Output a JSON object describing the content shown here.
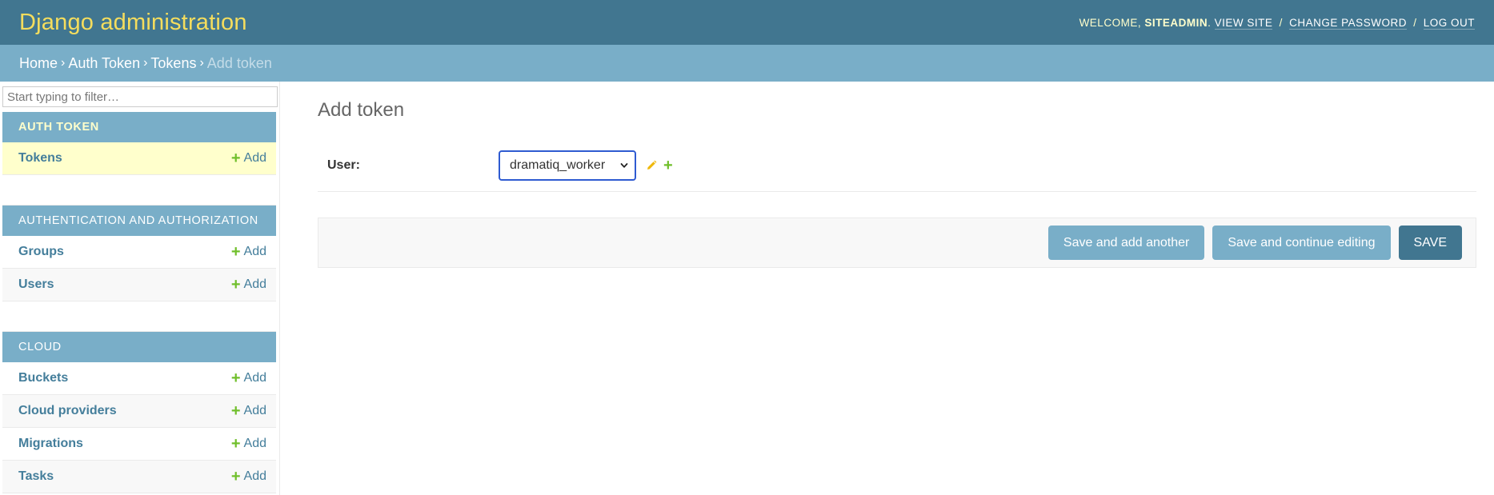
{
  "header": {
    "site_name": "Django administration",
    "welcome": "Welcome,",
    "username": "SITEADMIN",
    "links": [
      "View site",
      "Change password",
      "Log out"
    ]
  },
  "breadcrumbs": {
    "items": [
      "Home",
      "Auth Token",
      "Tokens"
    ],
    "current": "Add token"
  },
  "sidebar": {
    "filter_placeholder": "Start typing to filter…",
    "add_label": "Add",
    "modules": [
      {
        "caption": "Auth Token",
        "models": [
          "Tokens"
        ]
      },
      {
        "caption": "Authentication and Authorization",
        "models": [
          "Groups",
          "Users"
        ]
      },
      {
        "caption": "Cloud",
        "models": [
          "Buckets",
          "Cloud providers",
          "Migrations",
          "Tasks"
        ]
      }
    ]
  },
  "content": {
    "title": "Add token",
    "user_label": "User:",
    "user_value": "dramatiq_worker",
    "buttons": {
      "save_add_another": "Save and add another",
      "save_continue": "Save and continue editing",
      "save": "SAVE"
    }
  },
  "colors": {
    "header_bg": "#417690",
    "breadcrumbs_bg": "#79aec8",
    "site_name": "#f5dd5d",
    "link": "#447e9b",
    "add_icon": "#70bf2b",
    "current_row": "#ffffcc"
  }
}
